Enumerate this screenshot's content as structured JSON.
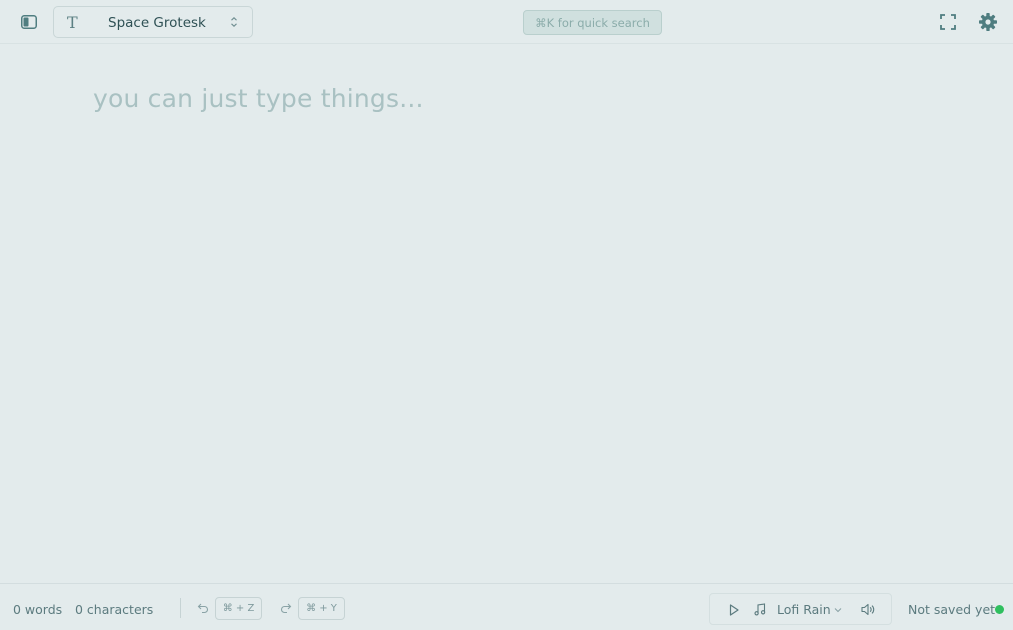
{
  "header": {
    "font_icon_glyph": "T",
    "font_name": "Space Grotesk",
    "quick_search_label": "⌘K for quick search"
  },
  "editor": {
    "placeholder": "you can just type things..."
  },
  "footer": {
    "words": "0 words",
    "characters": "0 characters",
    "undo_shortcut": "⌘ + Z",
    "redo_shortcut": "⌘ + Y",
    "track_name": "Lofi Rain",
    "save_status": "Not saved yet"
  },
  "colors": {
    "background": "#e3ebec",
    "accent": "#4f7d80",
    "saved_indicator": "#2fbf5f"
  },
  "icons": {
    "sidebar_toggle": "sidebar-panel-icon",
    "font": "type-icon",
    "font_select": "chevron-up-down-icon",
    "fullscreen": "expand-icon",
    "settings": "gear-icon",
    "undo": "undo-icon",
    "redo": "redo-icon",
    "play": "play-icon",
    "music": "music-note-icon",
    "track_select": "chevron-down-icon",
    "volume": "volume-icon"
  }
}
